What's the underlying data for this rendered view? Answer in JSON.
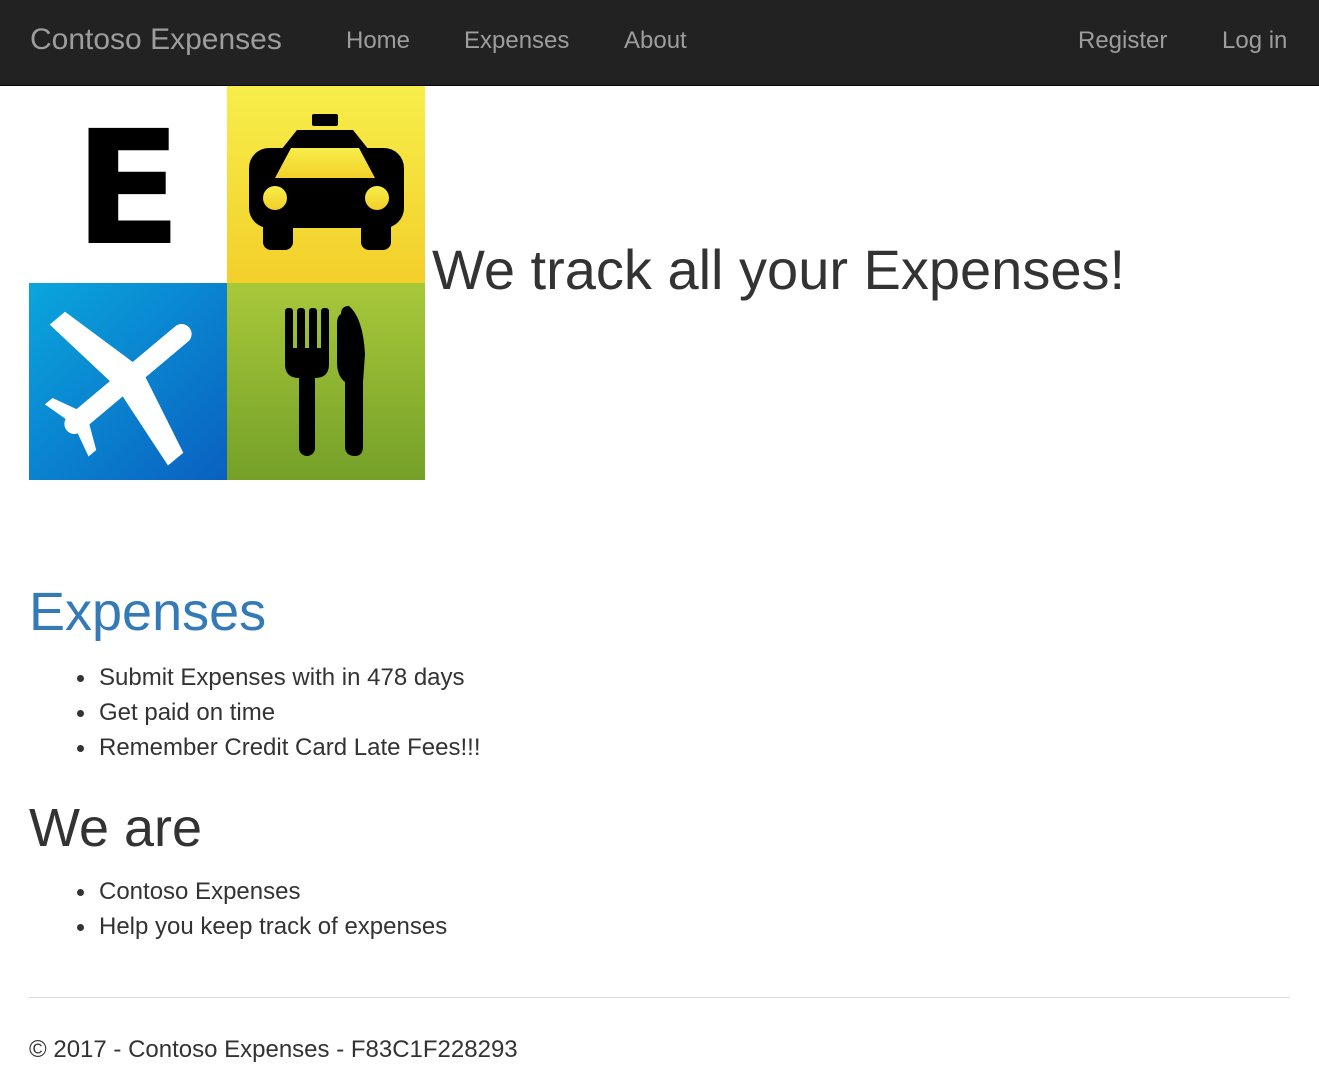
{
  "navbar": {
    "brand": "Contoso Expenses",
    "links": [
      "Home",
      "Expenses",
      "About"
    ],
    "right_links": [
      "Register",
      "Log in"
    ]
  },
  "hero": {
    "logo_letter": "E",
    "logo_icons": [
      "taxi-icon",
      "airplane-icon",
      "fork-knife-icon"
    ],
    "title": "We track all your Expenses!"
  },
  "expenses_section": {
    "heading": "Expenses",
    "items": [
      "Submit Expenses with in 478 days",
      "Get paid on time",
      "Remember Credit Card Late Fees!!!"
    ]
  },
  "about_section": {
    "heading": "We are",
    "items": [
      "Contoso Expenses",
      "Help you keep track of expenses"
    ]
  },
  "footer": {
    "text": "© 2017 - Contoso Expenses - F83C1F228293"
  },
  "colors": {
    "navbar_bg": "#222222",
    "nav_text": "#9d9d9d",
    "link_blue": "#337ab7",
    "tile_yellow": "#f5e03a",
    "tile_blue": "#0a8fd0",
    "tile_green": "#8dbb2f"
  }
}
